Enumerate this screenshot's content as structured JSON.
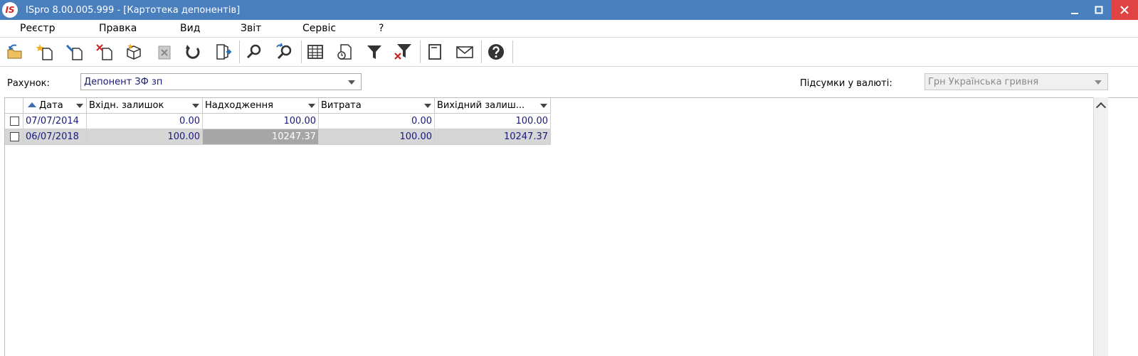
{
  "window": {
    "title": "ISpro 8.00.005.999 - [Картотека депонентів]",
    "logo_text": "IS"
  },
  "menu": [
    "Реєстр",
    "Правка",
    "Вид",
    "Звіт",
    "Сервіс",
    "?"
  ],
  "toolbar": {
    "icons": [
      "open-folder-icon",
      "new-document-icon",
      "edit-document-icon",
      "delete-document-icon",
      "package-icon",
      "clear-icon",
      "refresh-icon",
      "exit-icon",
      "find-icon",
      "find-next-icon",
      "table-icon",
      "document-clock-icon",
      "filter-icon",
      "clear-filter-icon",
      "notepad-icon",
      "mail-icon",
      "help-icon"
    ]
  },
  "filters": {
    "account_label": "Рахунок:",
    "account_value": "Депонент ЗФ зп",
    "currency_label": "Підсумки у валюті:",
    "currency_value": "Грн Українська гривня"
  },
  "grid": {
    "columns": [
      "Дата",
      "Вхідн. залишок",
      "Надходження",
      "Витрата",
      "Вихідний залиш..."
    ],
    "rows": [
      {
        "date": "07/07/2014",
        "opening": "0.00",
        "income": "100.00",
        "expense": "0.00",
        "closing": "100.00"
      },
      {
        "date": "06/07/2018",
        "opening": "100.00",
        "income": "10247.37",
        "expense": "100.00",
        "closing": "10247.37"
      }
    ]
  },
  "colors": {
    "titlebar": "#4a7fbe",
    "close": "#e04343",
    "row_text": "#1a1a7a",
    "selected_row": "#d6d6d6",
    "focused_cell": "#a6a6a6",
    "sort_arrow": "#3e6fb5"
  }
}
